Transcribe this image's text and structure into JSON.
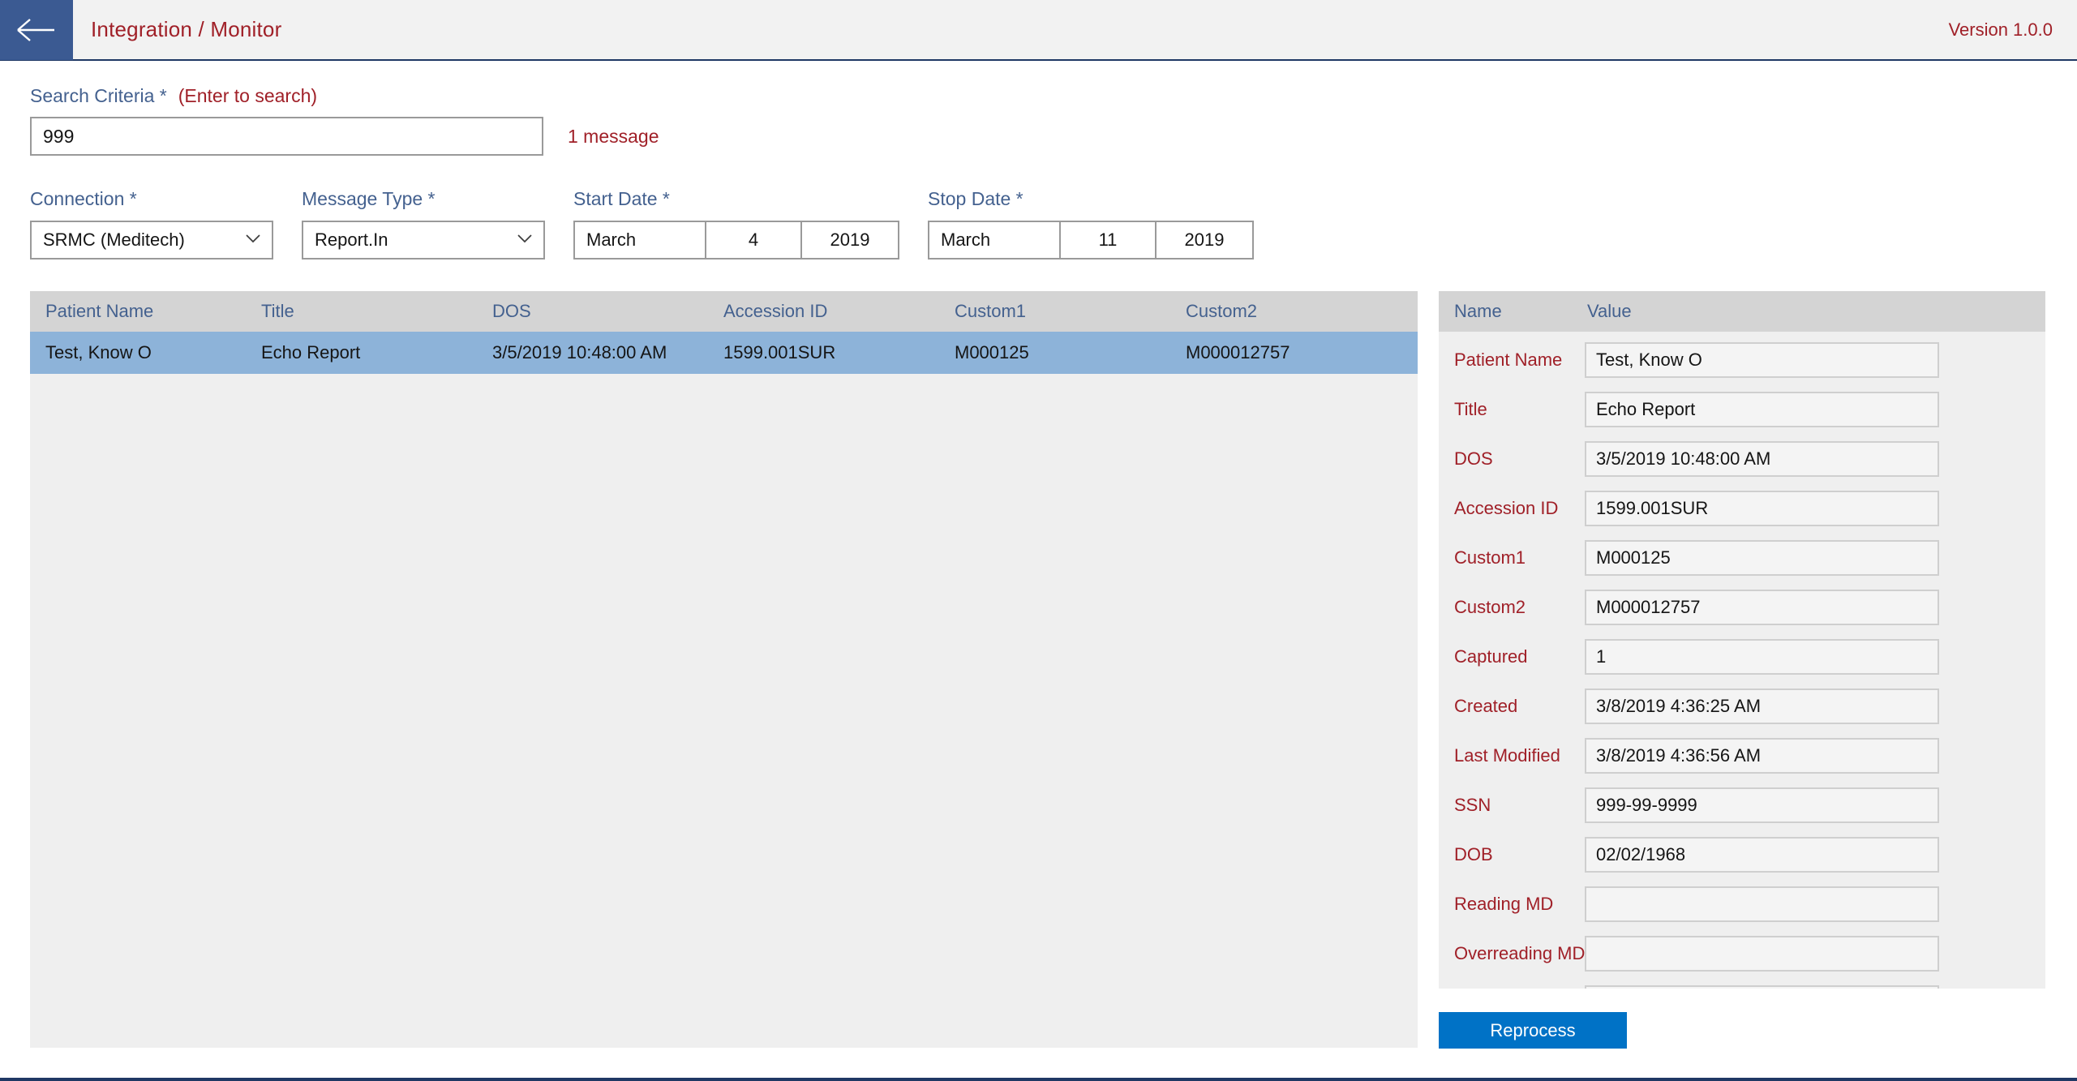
{
  "titlebar": {
    "back_icon": "arrow-left-icon",
    "title": "Integration / Monitor",
    "version": "Version 1.0.0"
  },
  "search": {
    "label": "Search Criteria *",
    "hint": "(Enter to search)",
    "value": "999",
    "placeholder": "",
    "message_count": "1 message"
  },
  "filters": {
    "connection": {
      "label": "Connection *",
      "value": "SRMC (Meditech)",
      "icon": "chevron-down-icon"
    },
    "message_type": {
      "label": "Message Type *",
      "value": "Report.In",
      "icon": "chevron-down-icon"
    },
    "start_date": {
      "label": "Start Date *",
      "month": "March",
      "day": "4",
      "year": "2019"
    },
    "stop_date": {
      "label": "Stop Date *",
      "month": "March",
      "day": "11",
      "year": "2019"
    }
  },
  "grid": {
    "columns": [
      "Patient Name",
      "Title",
      "DOS",
      "Accession ID",
      "Custom1",
      "Custom2"
    ],
    "rows": [
      {
        "selected": true,
        "cells": [
          "Test, Know O",
          "Echo Report",
          "3/5/2019 10:48:00 AM",
          "1599.001SUR",
          "M000125",
          "M000012757"
        ]
      }
    ]
  },
  "detail": {
    "columns": [
      "Name",
      "Value"
    ],
    "rows": [
      {
        "name": "Patient Name",
        "value": "Test, Know O"
      },
      {
        "name": "Title",
        "value": "Echo Report"
      },
      {
        "name": "DOS",
        "value": "3/5/2019 10:48:00 AM"
      },
      {
        "name": "Accession ID",
        "value": "1599.001SUR"
      },
      {
        "name": "Custom1",
        "value": "M000125"
      },
      {
        "name": "Custom2",
        "value": "M000012757"
      },
      {
        "name": "Captured",
        "value": "1"
      },
      {
        "name": "Created",
        "value": "3/8/2019 4:36:25 AM"
      },
      {
        "name": "Last Modified",
        "value": "3/8/2019 4:36:56 AM"
      },
      {
        "name": "SSN",
        "value": "999-99-9999"
      },
      {
        "name": "DOB",
        "value": "02/02/1968"
      },
      {
        "name": "Reading MD",
        "value": ""
      },
      {
        "name": "Overreading MD",
        "value": ""
      },
      {
        "name": "",
        "value": ""
      }
    ]
  },
  "actions": {
    "reprocess_label": "Reprocess"
  },
  "colors": {
    "accent_blue": "#0072c6",
    "label_blue": "#44618f",
    "label_red": "#a02028",
    "selection": "#8db3d9",
    "header_gray": "#d4d4d4",
    "panel_gray": "#efefef",
    "titlebar_back": "#3b5a92"
  }
}
